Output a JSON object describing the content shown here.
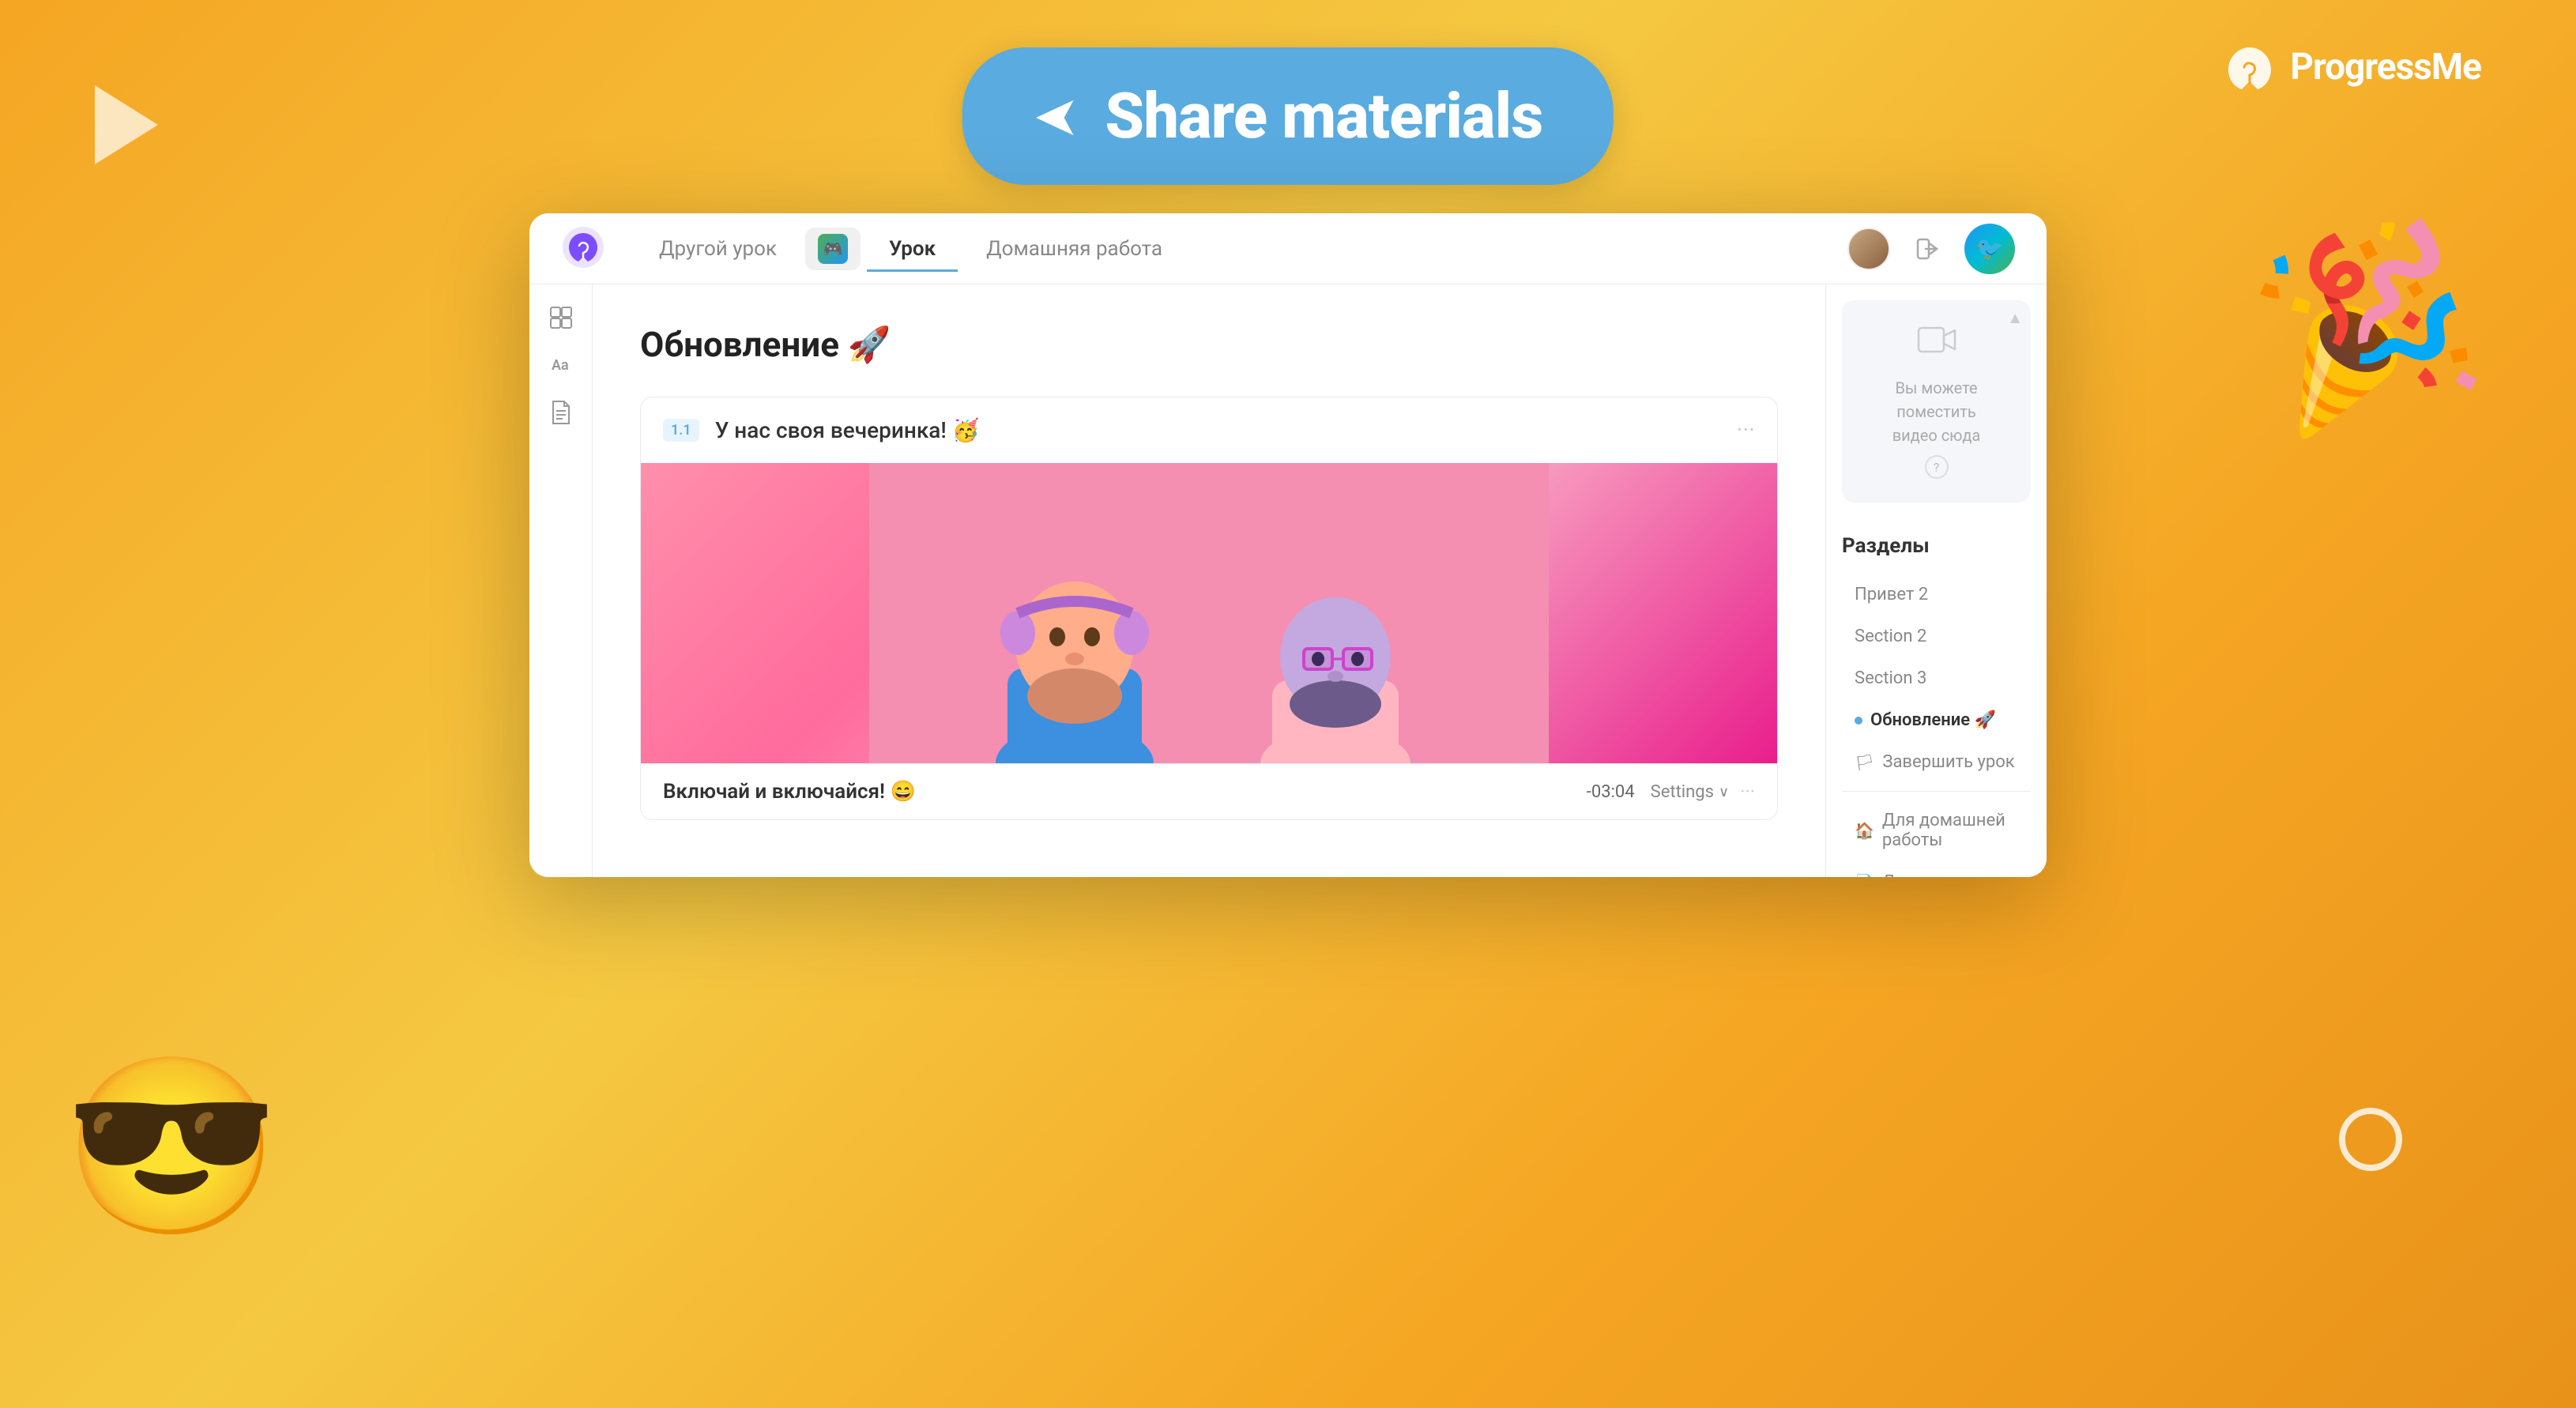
{
  "app": {
    "name": "ProgressMe"
  },
  "share_button": {
    "label": "Share materials"
  },
  "nav": {
    "tabs": [
      {
        "id": "other-lesson",
        "label": "Другой урок",
        "active": false
      },
      {
        "id": "game",
        "label": "",
        "active": false,
        "has_icon": true
      },
      {
        "id": "lesson",
        "label": "Урок",
        "active": true
      },
      {
        "id": "homework",
        "label": "Домашняя работа",
        "active": false
      }
    ]
  },
  "sidebar_icons": [
    {
      "name": "layout-icon",
      "symbol": "⊞"
    },
    {
      "name": "text-icon",
      "symbol": "Aa"
    },
    {
      "name": "document-icon",
      "symbol": "📄"
    }
  ],
  "lesson": {
    "title": "Обновление 🚀",
    "block": {
      "number": "1.1",
      "title": "У нас своя вечеринка! 🥳"
    },
    "bottom_bar": {
      "title": "Включай и включайся! 😄",
      "time": "-03:04",
      "settings_label": "Settings"
    }
  },
  "video_panel": {
    "icon": "📹",
    "line1": "Вы можете поместить",
    "line2": "видео сюда",
    "help": "?"
  },
  "sections": {
    "title": "Разделы",
    "items": [
      {
        "id": "privet2",
        "label": "Привет 2",
        "type": "plain",
        "active": false
      },
      {
        "id": "section2",
        "label": "Section 2",
        "type": "plain",
        "active": false
      },
      {
        "id": "section3",
        "label": "Section 3",
        "type": "plain",
        "active": false
      },
      {
        "id": "obnovlenie",
        "label": "Обновление 🚀",
        "type": "dot-active",
        "active": true
      },
      {
        "id": "finish",
        "label": "Завершить урок",
        "type": "flag",
        "active": false
      },
      {
        "id": "homework",
        "label": "Для домашней работы",
        "type": "home",
        "active": false
      },
      {
        "id": "additional",
        "label": "Дополнительно",
        "type": "doc",
        "active": false
      }
    ]
  }
}
